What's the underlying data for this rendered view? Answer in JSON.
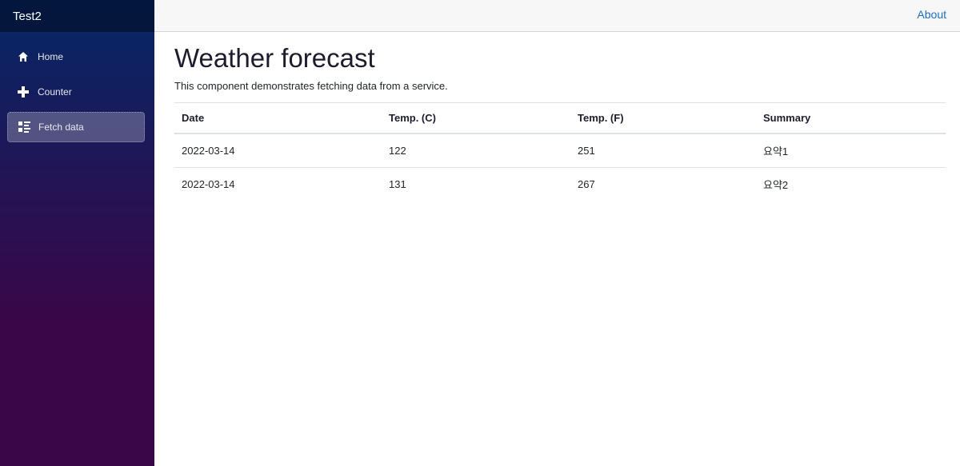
{
  "brand": {
    "title": "Test2"
  },
  "nav": {
    "items": [
      {
        "label": "Home",
        "icon": "home-icon"
      },
      {
        "label": "Counter",
        "icon": "plus-icon"
      },
      {
        "label": "Fetch data",
        "icon": "list-rich-icon",
        "active": true
      }
    ]
  },
  "topbar": {
    "about_label": "About"
  },
  "page": {
    "title": "Weather forecast",
    "subtitle": "This component demonstrates fetching data from a service."
  },
  "table": {
    "headers": [
      "Date",
      "Temp. (C)",
      "Temp. (F)",
      "Summary"
    ],
    "rows": [
      [
        "2022-03-14",
        "122",
        "251",
        "요약1"
      ],
      [
        "2022-03-14",
        "131",
        "267",
        "요약2"
      ]
    ]
  },
  "colors": {
    "sidebar_top": "#052767",
    "sidebar_bottom": "#3a0647",
    "link": "#1b6ec2",
    "topbar_bg": "#f7f7f7"
  }
}
